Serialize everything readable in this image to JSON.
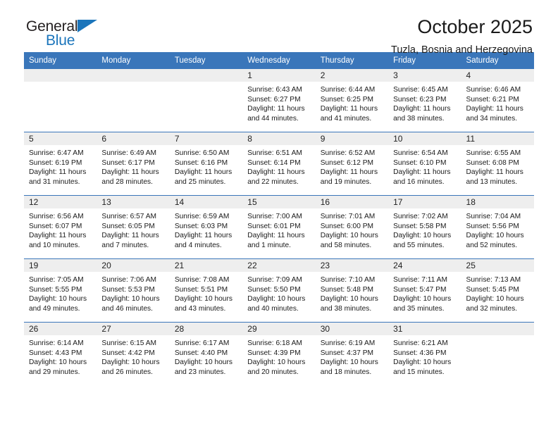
{
  "logo": {
    "word_one": "General",
    "word_two": "Blue",
    "triangle_icon": "triangle-icon",
    "accent_color": "#1b75bb"
  },
  "header": {
    "title": "October 2025",
    "subtitle": "Tuzla, Bosnia and Herzegovina",
    "header_color": "#3a76ba",
    "daynum_color": "#eeeeee"
  },
  "weekday_headers": [
    "Sunday",
    "Monday",
    "Tuesday",
    "Wednesday",
    "Thursday",
    "Friday",
    "Saturday"
  ],
  "weeks": [
    [
      {
        "day": "",
        "sunrise": "",
        "sunset": "",
        "daylight_line1": "",
        "daylight_line2": ""
      },
      {
        "day": "",
        "sunrise": "",
        "sunset": "",
        "daylight_line1": "",
        "daylight_line2": ""
      },
      {
        "day": "",
        "sunrise": "",
        "sunset": "",
        "daylight_line1": "",
        "daylight_line2": ""
      },
      {
        "day": "1",
        "sunrise": "Sunrise: 6:43 AM",
        "sunset": "Sunset: 6:27 PM",
        "daylight_line1": "Daylight: 11 hours",
        "daylight_line2": "and 44 minutes."
      },
      {
        "day": "2",
        "sunrise": "Sunrise: 6:44 AM",
        "sunset": "Sunset: 6:25 PM",
        "daylight_line1": "Daylight: 11 hours",
        "daylight_line2": "and 41 minutes."
      },
      {
        "day": "3",
        "sunrise": "Sunrise: 6:45 AM",
        "sunset": "Sunset: 6:23 PM",
        "daylight_line1": "Daylight: 11 hours",
        "daylight_line2": "and 38 minutes."
      },
      {
        "day": "4",
        "sunrise": "Sunrise: 6:46 AM",
        "sunset": "Sunset: 6:21 PM",
        "daylight_line1": "Daylight: 11 hours",
        "daylight_line2": "and 34 minutes."
      }
    ],
    [
      {
        "day": "5",
        "sunrise": "Sunrise: 6:47 AM",
        "sunset": "Sunset: 6:19 PM",
        "daylight_line1": "Daylight: 11 hours",
        "daylight_line2": "and 31 minutes."
      },
      {
        "day": "6",
        "sunrise": "Sunrise: 6:49 AM",
        "sunset": "Sunset: 6:17 PM",
        "daylight_line1": "Daylight: 11 hours",
        "daylight_line2": "and 28 minutes."
      },
      {
        "day": "7",
        "sunrise": "Sunrise: 6:50 AM",
        "sunset": "Sunset: 6:16 PM",
        "daylight_line1": "Daylight: 11 hours",
        "daylight_line2": "and 25 minutes."
      },
      {
        "day": "8",
        "sunrise": "Sunrise: 6:51 AM",
        "sunset": "Sunset: 6:14 PM",
        "daylight_line1": "Daylight: 11 hours",
        "daylight_line2": "and 22 minutes."
      },
      {
        "day": "9",
        "sunrise": "Sunrise: 6:52 AM",
        "sunset": "Sunset: 6:12 PM",
        "daylight_line1": "Daylight: 11 hours",
        "daylight_line2": "and 19 minutes."
      },
      {
        "day": "10",
        "sunrise": "Sunrise: 6:54 AM",
        "sunset": "Sunset: 6:10 PM",
        "daylight_line1": "Daylight: 11 hours",
        "daylight_line2": "and 16 minutes."
      },
      {
        "day": "11",
        "sunrise": "Sunrise: 6:55 AM",
        "sunset": "Sunset: 6:08 PM",
        "daylight_line1": "Daylight: 11 hours",
        "daylight_line2": "and 13 minutes."
      }
    ],
    [
      {
        "day": "12",
        "sunrise": "Sunrise: 6:56 AM",
        "sunset": "Sunset: 6:07 PM",
        "daylight_line1": "Daylight: 11 hours",
        "daylight_line2": "and 10 minutes."
      },
      {
        "day": "13",
        "sunrise": "Sunrise: 6:57 AM",
        "sunset": "Sunset: 6:05 PM",
        "daylight_line1": "Daylight: 11 hours",
        "daylight_line2": "and 7 minutes."
      },
      {
        "day": "14",
        "sunrise": "Sunrise: 6:59 AM",
        "sunset": "Sunset: 6:03 PM",
        "daylight_line1": "Daylight: 11 hours",
        "daylight_line2": "and 4 minutes."
      },
      {
        "day": "15",
        "sunrise": "Sunrise: 7:00 AM",
        "sunset": "Sunset: 6:01 PM",
        "daylight_line1": "Daylight: 11 hours",
        "daylight_line2": "and 1 minute."
      },
      {
        "day": "16",
        "sunrise": "Sunrise: 7:01 AM",
        "sunset": "Sunset: 6:00 PM",
        "daylight_line1": "Daylight: 10 hours",
        "daylight_line2": "and 58 minutes."
      },
      {
        "day": "17",
        "sunrise": "Sunrise: 7:02 AM",
        "sunset": "Sunset: 5:58 PM",
        "daylight_line1": "Daylight: 10 hours",
        "daylight_line2": "and 55 minutes."
      },
      {
        "day": "18",
        "sunrise": "Sunrise: 7:04 AM",
        "sunset": "Sunset: 5:56 PM",
        "daylight_line1": "Daylight: 10 hours",
        "daylight_line2": "and 52 minutes."
      }
    ],
    [
      {
        "day": "19",
        "sunrise": "Sunrise: 7:05 AM",
        "sunset": "Sunset: 5:55 PM",
        "daylight_line1": "Daylight: 10 hours",
        "daylight_line2": "and 49 minutes."
      },
      {
        "day": "20",
        "sunrise": "Sunrise: 7:06 AM",
        "sunset": "Sunset: 5:53 PM",
        "daylight_line1": "Daylight: 10 hours",
        "daylight_line2": "and 46 minutes."
      },
      {
        "day": "21",
        "sunrise": "Sunrise: 7:08 AM",
        "sunset": "Sunset: 5:51 PM",
        "daylight_line1": "Daylight: 10 hours",
        "daylight_line2": "and 43 minutes."
      },
      {
        "day": "22",
        "sunrise": "Sunrise: 7:09 AM",
        "sunset": "Sunset: 5:50 PM",
        "daylight_line1": "Daylight: 10 hours",
        "daylight_line2": "and 40 minutes."
      },
      {
        "day": "23",
        "sunrise": "Sunrise: 7:10 AM",
        "sunset": "Sunset: 5:48 PM",
        "daylight_line1": "Daylight: 10 hours",
        "daylight_line2": "and 38 minutes."
      },
      {
        "day": "24",
        "sunrise": "Sunrise: 7:11 AM",
        "sunset": "Sunset: 5:47 PM",
        "daylight_line1": "Daylight: 10 hours",
        "daylight_line2": "and 35 minutes."
      },
      {
        "day": "25",
        "sunrise": "Sunrise: 7:13 AM",
        "sunset": "Sunset: 5:45 PM",
        "daylight_line1": "Daylight: 10 hours",
        "daylight_line2": "and 32 minutes."
      }
    ],
    [
      {
        "day": "26",
        "sunrise": "Sunrise: 6:14 AM",
        "sunset": "Sunset: 4:43 PM",
        "daylight_line1": "Daylight: 10 hours",
        "daylight_line2": "and 29 minutes."
      },
      {
        "day": "27",
        "sunrise": "Sunrise: 6:15 AM",
        "sunset": "Sunset: 4:42 PM",
        "daylight_line1": "Daylight: 10 hours",
        "daylight_line2": "and 26 minutes."
      },
      {
        "day": "28",
        "sunrise": "Sunrise: 6:17 AM",
        "sunset": "Sunset: 4:40 PM",
        "daylight_line1": "Daylight: 10 hours",
        "daylight_line2": "and 23 minutes."
      },
      {
        "day": "29",
        "sunrise": "Sunrise: 6:18 AM",
        "sunset": "Sunset: 4:39 PM",
        "daylight_line1": "Daylight: 10 hours",
        "daylight_line2": "and 20 minutes."
      },
      {
        "day": "30",
        "sunrise": "Sunrise: 6:19 AM",
        "sunset": "Sunset: 4:37 PM",
        "daylight_line1": "Daylight: 10 hours",
        "daylight_line2": "and 18 minutes."
      },
      {
        "day": "31",
        "sunrise": "Sunrise: 6:21 AM",
        "sunset": "Sunset: 4:36 PM",
        "daylight_line1": "Daylight: 10 hours",
        "daylight_line2": "and 15 minutes."
      },
      {
        "day": "",
        "sunrise": "",
        "sunset": "",
        "daylight_line1": "",
        "daylight_line2": ""
      }
    ]
  ]
}
